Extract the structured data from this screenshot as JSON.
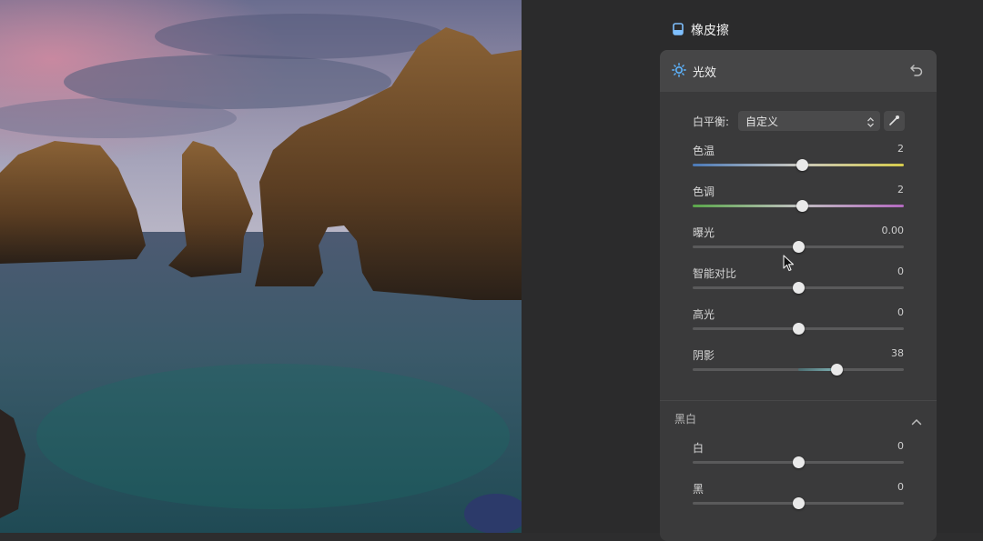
{
  "tool": {
    "label": "橡皮擦",
    "icon": "eraser-icon"
  },
  "light_panel": {
    "title": "光效",
    "icon": "sun-icon",
    "reset_icon": "undo-icon",
    "white_balance": {
      "label": "白平衡:",
      "selected": "自定义",
      "picker_icon": "eyedropper-icon"
    },
    "sliders": [
      {
        "label": "色温",
        "value": "2",
        "position": 0.5
      },
      {
        "label": "色调",
        "value": "2",
        "position": 0.5
      },
      {
        "label": "曝光",
        "value": "0.00",
        "position": 0.5
      },
      {
        "label": "智能对比",
        "value": "0",
        "position": 0.5
      },
      {
        "label": "高光",
        "value": "0",
        "position": 0.5
      },
      {
        "label": "阴影",
        "value": "38",
        "position": 0.68
      }
    ],
    "colors": {
      "temperature_track": [
        "#4a79b8",
        "#d6cc4c"
      ],
      "tint_track": [
        "#5aa64a",
        "#b469c0"
      ],
      "shadow_fill": "#7fb2b4"
    }
  },
  "bw_section": {
    "title": "黑白",
    "toggle_icon": "chevron-up-icon",
    "sliders": [
      {
        "label": "白",
        "value": "0",
        "position": 0.5
      },
      {
        "label": "黑",
        "value": "0",
        "position": 0.5
      }
    ]
  }
}
